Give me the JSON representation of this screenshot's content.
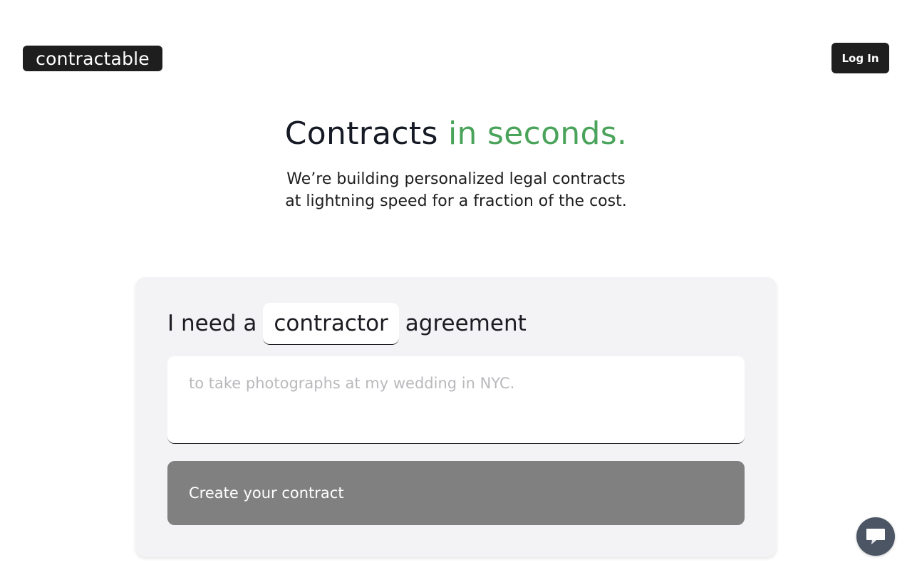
{
  "header": {
    "logo_text": "contractable",
    "login_label": "Log In"
  },
  "hero": {
    "title_main": "Contracts",
    "title_accent": "in seconds.",
    "subtitle_line1": "We’re building personalized legal contracts",
    "subtitle_line2": "at lightning speed for a fraction of the cost."
  },
  "form": {
    "prefix": "I need a",
    "agreement_type": "contractor",
    "suffix": "agreement",
    "description_value": "",
    "description_placeholder": "to take photographs at my wedding in NYC.",
    "submit_label": "Create your contract"
  },
  "chat": {
    "icon": "chat-bubble-icon"
  },
  "colors": {
    "accent": "#4aa35a",
    "dark": "#1e1e1e",
    "button_disabled": "#808080",
    "card_bg": "#f3f3f5",
    "chat_bg": "#4b5564"
  }
}
